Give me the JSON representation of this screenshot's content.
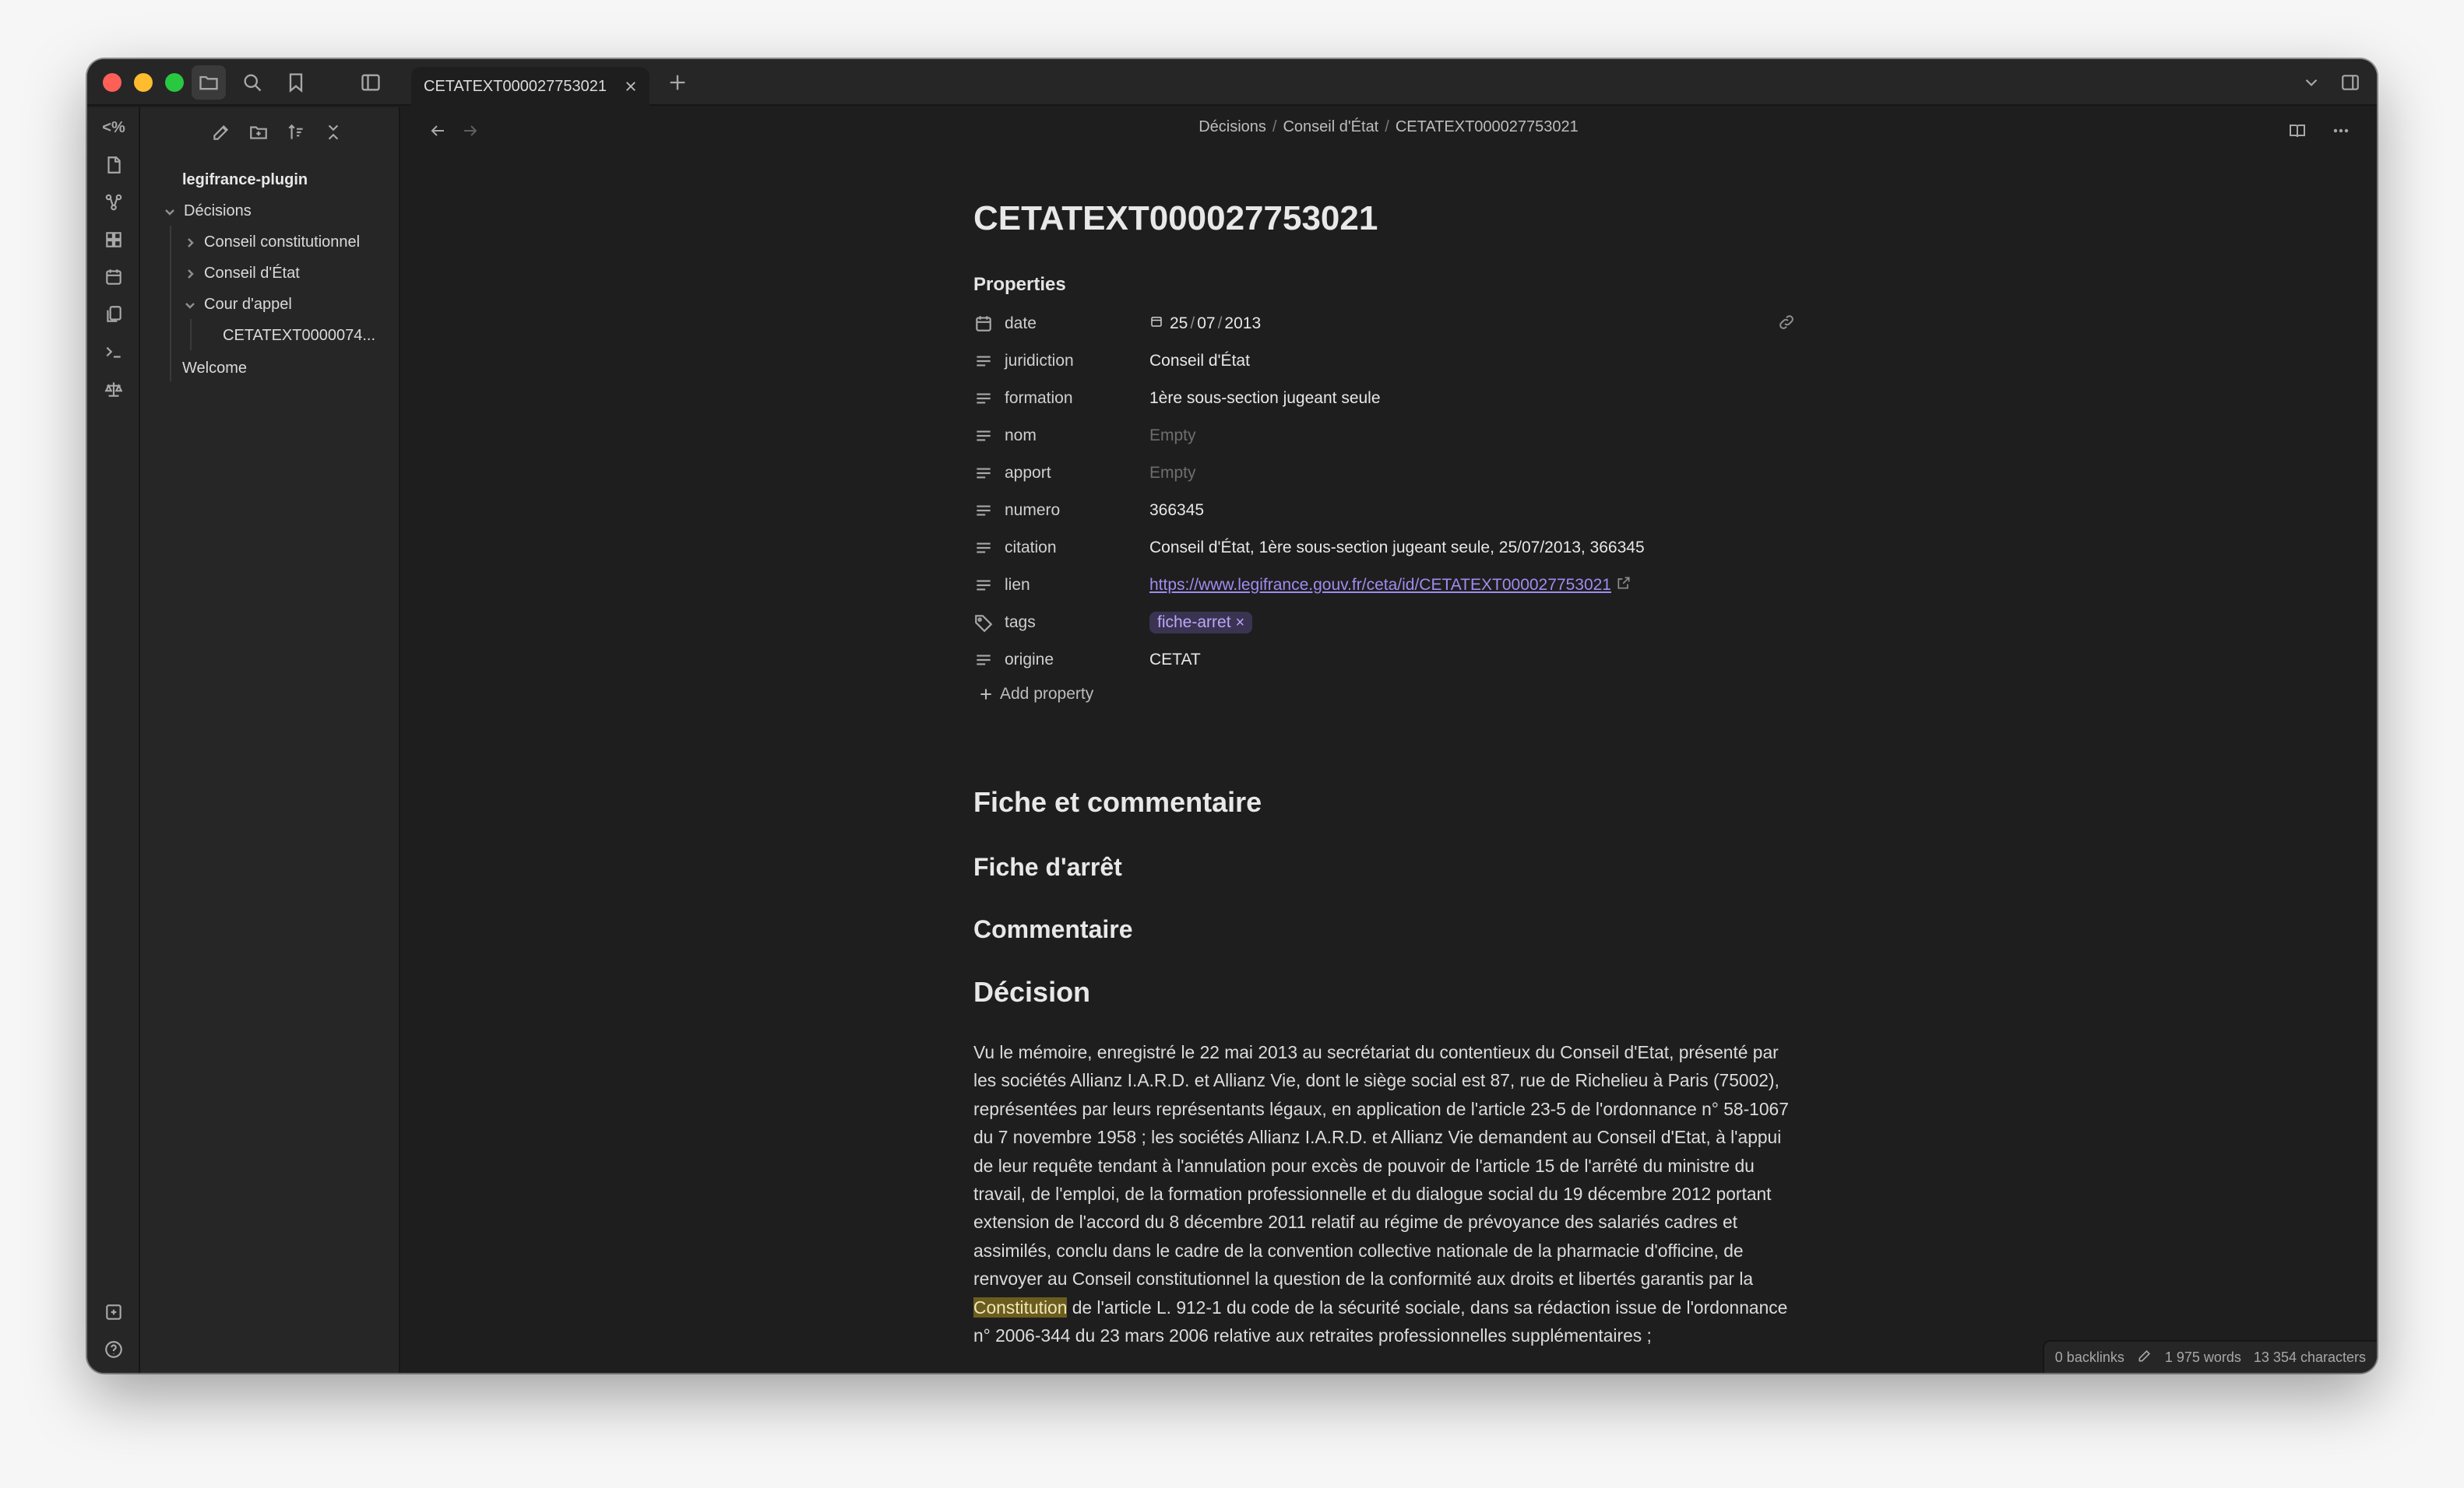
{
  "tab": {
    "label": "CETATEXT000027753021"
  },
  "sidebar": {
    "vault_name": "legifrance-plugin",
    "tree": [
      {
        "label": "Décisions",
        "expanded": true
      },
      {
        "label": "Conseil constitutionnel",
        "expanded": false
      },
      {
        "label": "Conseil d'État",
        "expanded": false
      },
      {
        "label": "Cour d'appel",
        "expanded": true
      },
      {
        "label": "CETATEXT0000074..."
      },
      {
        "label": "Welcome"
      }
    ]
  },
  "breadcrumb": {
    "part1": "Décisions",
    "part2": "Conseil d'État",
    "part3": "CETATEXT000027753021",
    "sep": "/"
  },
  "note": {
    "title": "CETATEXT000027753021",
    "properties_heading": "Properties",
    "properties": {
      "date": {
        "key": "date",
        "day": "25",
        "month": "07",
        "year": "2013"
      },
      "juridiction": {
        "key": "juridiction",
        "value": "Conseil d'État"
      },
      "formation": {
        "key": "formation",
        "value": "1ère sous-section jugeant seule"
      },
      "nom": {
        "key": "nom",
        "value": "Empty"
      },
      "apport": {
        "key": "apport",
        "value": "Empty"
      },
      "numero": {
        "key": "numero",
        "value": "366345"
      },
      "citation": {
        "key": "citation",
        "value": "Conseil d'État, 1ère sous-section jugeant seule, 25/07/2013, 366345"
      },
      "lien": {
        "key": "lien",
        "value": "https://www.legifrance.gouv.fr/ceta/id/CETATEXT000027753021"
      },
      "tags": {
        "key": "tags",
        "value": "fiche-arret",
        "remove": "×"
      },
      "origine": {
        "key": "origine",
        "value": "CETAT"
      }
    },
    "add_property": "Add property",
    "headings": {
      "h_fiche_commentaire": "Fiche et commentaire",
      "h_fiche_arret": "Fiche d'arrêt",
      "h_commentaire": "Commentaire",
      "h_decision": "Décision"
    },
    "body": {
      "before_highlight": "Vu le mémoire, enregistré le 22 mai 2013 au secrétariat du contentieux du Conseil d'Etat, présenté par les sociétés Allianz I.A.R.D. et Allianz Vie, dont le siège social est 87, rue de Richelieu à Paris (75002), représentées par leurs représentants légaux, en application de l'article 23-5 de l'ordonnance n° 58-1067 du 7 novembre 1958 ; les sociétés Allianz I.A.R.D. et Allianz Vie demandent au Conseil d'Etat, à l'appui de leur requête tendant à l'annulation pour excès de pouvoir de l'article 15 de l'arrêté du ministre du travail, de l'emploi, de la formation professionnelle et du dialogue social du 19 décembre 2012 portant extension de l'accord du 8 décembre 2011 relatif au régime de prévoyance des salariés cadres et assimilés, conclu dans le cadre de la convention collective nationale de la pharmacie d'officine, de renvoyer au Conseil constitutionnel la question de la conformité aux droits et libertés garantis par la ",
      "highlight": "Constitution",
      "after_highlight": " de l'article L. 912-1 du code de la sécurité sociale, dans sa rédaction issue de l'ordonnance n° 2006-344 du 23 mars 2006 relative aux retraites professionnelles supplémentaires ;"
    }
  },
  "ribbon": {
    "top_glyph": "<%"
  },
  "status": {
    "backlinks": "0 backlinks",
    "words": "1 975 words",
    "characters": "13 354 characters"
  },
  "colors": {
    "accent": "#a08cf0",
    "highlight": "#6b5d1e",
    "background": "#1e1e1e",
    "sidebar": "#262626"
  },
  "icons": [
    "folder-icon",
    "search-icon",
    "bookmark-icon",
    "sidebar-toggle-icon",
    "close-icon",
    "plus-icon",
    "chevron-down-icon",
    "right-sidebar-icon",
    "new-note-icon",
    "new-folder-icon",
    "sort-icon",
    "collapse-icon",
    "back-arrow-icon",
    "forward-arrow-icon",
    "reading-view-icon",
    "more-options-icon",
    "calendar-icon",
    "text-lines-icon",
    "tag-icon",
    "link-icon",
    "external-link-icon",
    "pencil-icon",
    "help-icon",
    "settings-icon",
    "vault-icon"
  ]
}
